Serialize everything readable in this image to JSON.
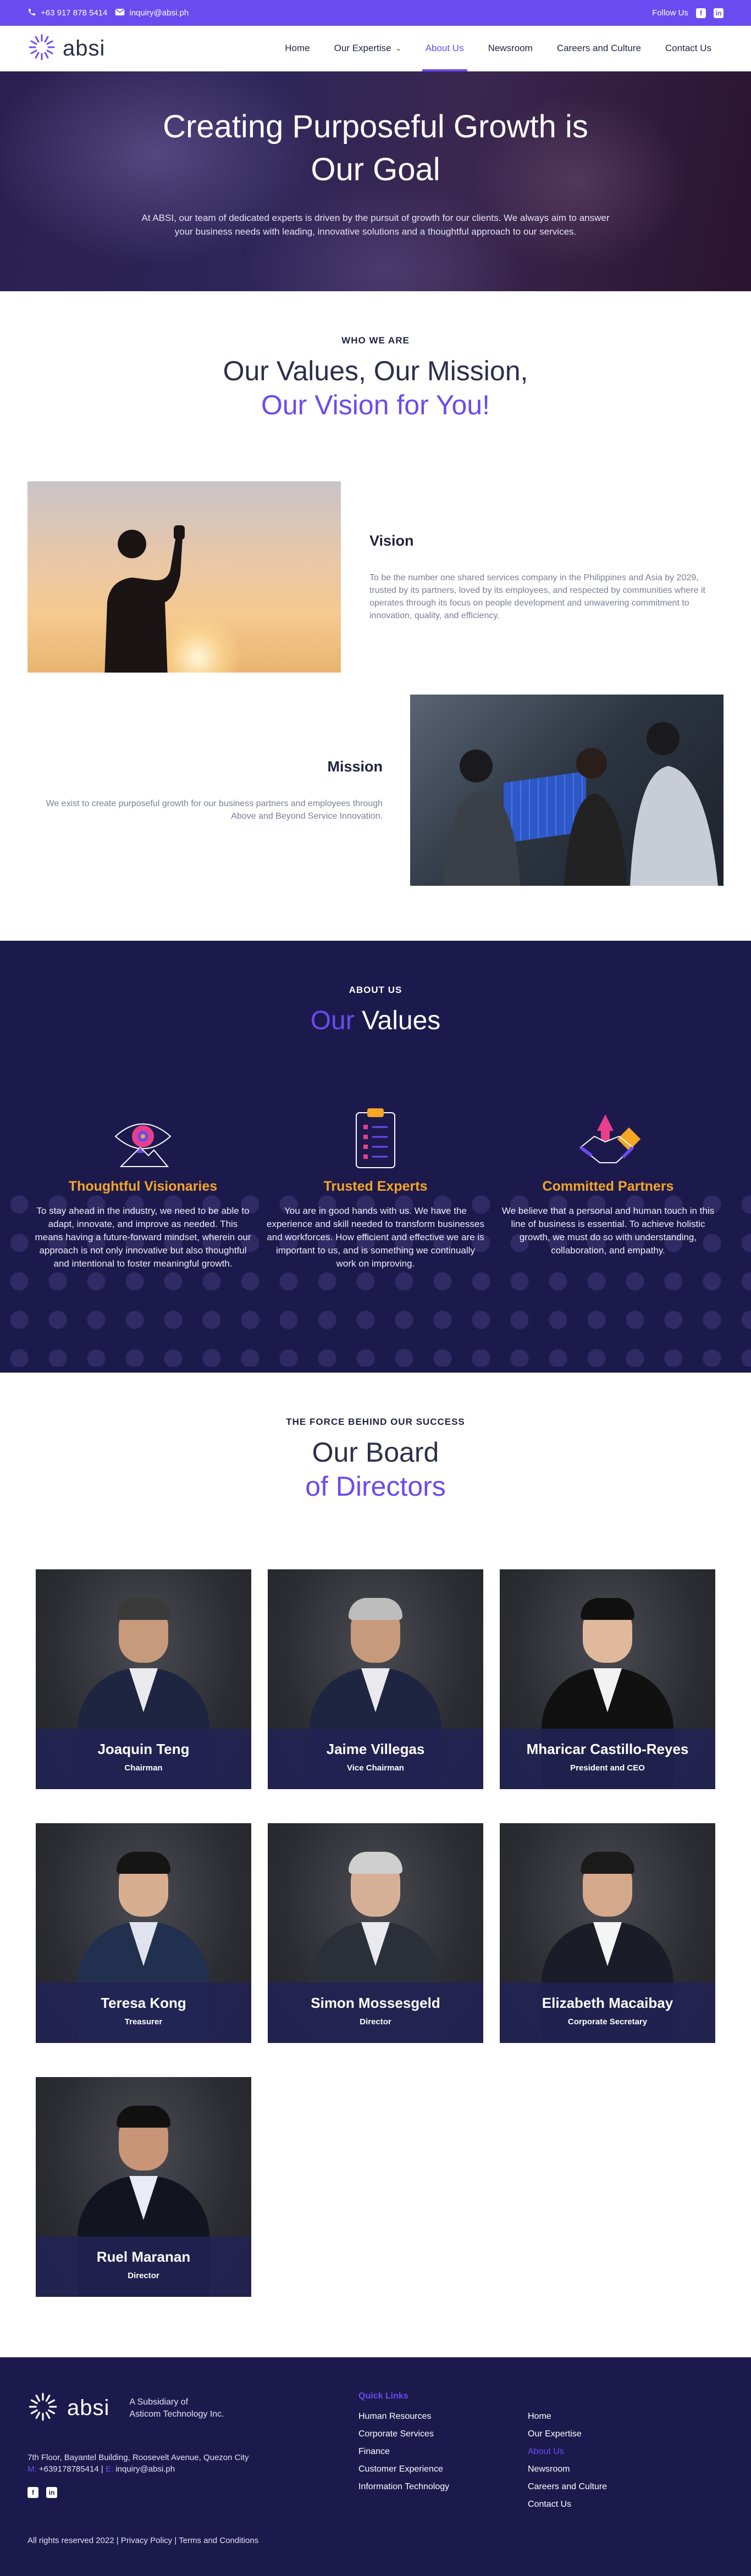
{
  "topbar": {
    "phone": "+63 917 878 5414",
    "email": "inquiry@absi.ph",
    "follow_label": "Follow Us"
  },
  "nav": {
    "logo": "absi",
    "items": [
      {
        "label": "Home"
      },
      {
        "label": "Our Expertise"
      },
      {
        "label": "About Us"
      },
      {
        "label": "Newsroom"
      },
      {
        "label": "Careers and Culture"
      },
      {
        "label": "Contact Us"
      }
    ]
  },
  "hero": {
    "title_line1": "Creating Purposeful Growth is",
    "title_line2": "Our Goal",
    "subtitle": "At ABSI, our team of dedicated experts is driven by the pursuit of growth for our clients. We always aim to answer your business needs with leading, innovative solutions and a thoughtful approach to our services."
  },
  "who": {
    "eyebrow": "WHO WE ARE",
    "title_line1": "Our Values, Our Mission,",
    "title_line2": "Our Vision for You!",
    "vision_title": "Vision",
    "vision_text": "To be the number one shared services company in the Philippines and Asia by 2029, trusted by its partners, loved by its employees, and respected by communities where it operates through its focus on people development and unwavering commitment to innovation, quality, and efficiency.",
    "mission_title": "Mission",
    "mission_text": "We exist to create purposeful growth for our business partners and employees through Above and Beyond Service Innovation."
  },
  "values": {
    "eyebrow": "ABOUT US",
    "title_accent": "Our",
    "title_rest": "Values",
    "cards": [
      {
        "title": "Thoughtful Visionaries",
        "text": "To stay ahead in the industry, we need to be able to adapt, innovate, and improve as needed. This means having a future-forward mindset, wherein our approach is not only innovative but also thoughtful and intentional to foster meaningful growth."
      },
      {
        "title": "Trusted Experts",
        "text": "You are in good hands with us. We have the experience and skill needed to transform businesses and workforces. How efficient and effective we are is important to us, and is something we continually work on improving."
      },
      {
        "title": "Committed Partners",
        "text": "We believe that a personal and human touch in this line of business is essential. To achieve holistic growth, we must do so with understanding, collaboration, and empathy."
      }
    ]
  },
  "board": {
    "eyebrow": "THE FORCE BEHIND OUR SUCCESS",
    "title_line1": "Our Board",
    "title_line2": "of Directors",
    "directors": [
      {
        "name": "Joaquin Teng",
        "role": "Chairman"
      },
      {
        "name": "Jaime Villegas",
        "role": "Vice Chairman"
      },
      {
        "name": "Mharicar Castillo-Reyes",
        "role": "President and CEO"
      },
      {
        "name": "Teresa Kong",
        "role": "Treasurer"
      },
      {
        "name": "Simon Mossesgeld",
        "role": "Director"
      },
      {
        "name": "Elizabeth Macaibay",
        "role": "Corporate Secretary"
      },
      {
        "name": "Ruel Maranan",
        "role": "Director"
      }
    ]
  },
  "footer": {
    "logo": "absi",
    "subsidiary_line1": "A Subsidiary of",
    "subsidiary_line2": "Asticom Technology Inc.",
    "address": "7th Floor, Bayantel Building, Roosevelt Avenue, Quezon City",
    "mobile_label": "M:",
    "mobile": "+639178785414",
    "email_label": "E:",
    "email": "inquiry@absi.ph",
    "quick_links_title": "Quick Links",
    "quick_links": [
      "Human Resources",
      "Corporate Services",
      "Finance",
      "Customer Experience",
      "Information Technology"
    ],
    "site_links": [
      "Home",
      "Our Expertise",
      "About Us",
      "Newsroom",
      "Careers and Culture",
      "Contact Us"
    ],
    "copyright": "All rights reserved 2022 | Privacy Policy | Terms and Conditions"
  },
  "colors": {
    "brand": "#6a4bf0",
    "navy": "#1c1a4d",
    "gold": "#f5a623"
  }
}
